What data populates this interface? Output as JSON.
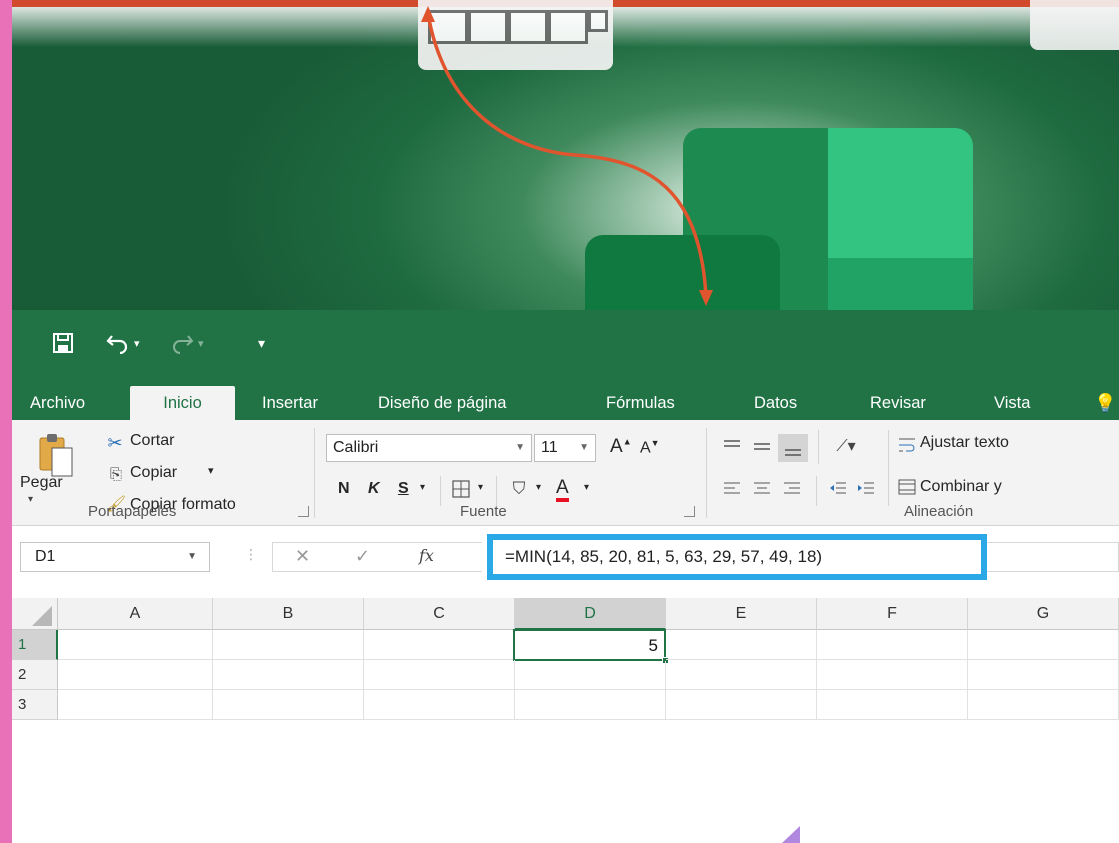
{
  "colors": {
    "excel_green": "#217346",
    "highlight_blue": "#2aa9e6",
    "arrow_orange": "#e0552e",
    "pink_accent": "#e871b7",
    "font_red": "#e81123"
  },
  "icons": {
    "save": "save-icon",
    "undo": "undo-icon",
    "redo": "redo-icon",
    "customize": "customize-qat-icon"
  },
  "tabs": [
    "Archivo",
    "Inicio",
    "Insertar",
    "Diseño de página",
    "Fórmulas",
    "Datos",
    "Revisar",
    "Vista"
  ],
  "ribbon": {
    "clipboard": {
      "paste": "Pegar",
      "cut": "Cortar",
      "copy": "Copiar",
      "format_painter": "Copiar formato",
      "group_label": "Portapapeles"
    },
    "font": {
      "font_name": "Calibri",
      "font_size": "11",
      "bold": "N",
      "italic": "K",
      "underline": "S",
      "grow_font": "A",
      "shrink_font": "A",
      "font_color": "A",
      "group_label": "Fuente"
    },
    "alignment": {
      "wrap_text": "Ajustar texto",
      "merge_center": "Combinar y",
      "group_label": "Alineación"
    }
  },
  "formula_bar": {
    "name_box": "D1",
    "cancel": "✕",
    "enter": "✓",
    "fx": "fx",
    "formula": "=MIN(14, 85, 20, 81, 5, 63, 29, 57, 49, 18)"
  },
  "sheet": {
    "columns": [
      "A",
      "B",
      "C",
      "D",
      "E",
      "F",
      "G"
    ],
    "rows": [
      "1",
      "2",
      "3"
    ],
    "active_cell_value": "5"
  }
}
